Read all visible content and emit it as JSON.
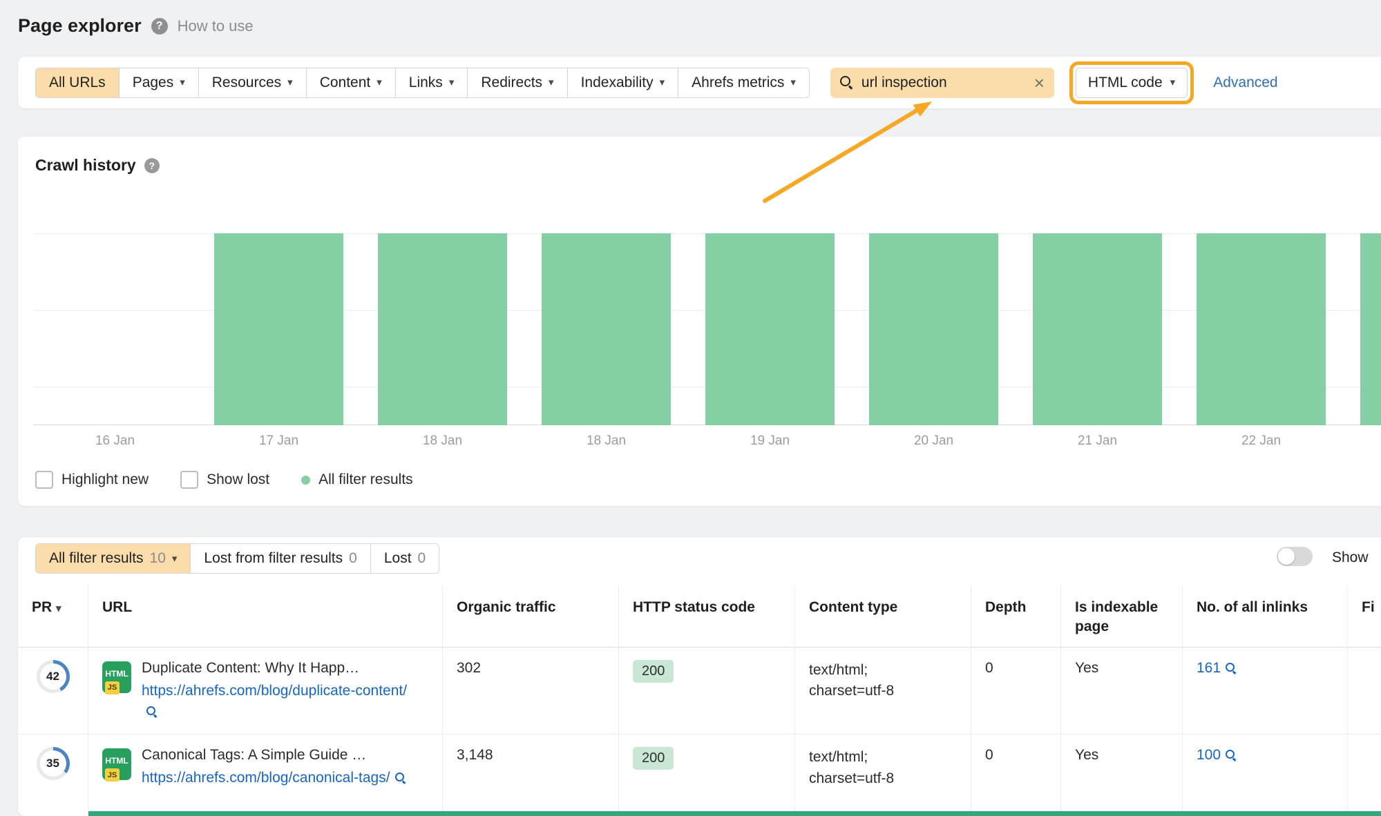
{
  "page": {
    "title": "Page explorer",
    "help_label": "How to use"
  },
  "colors": {
    "accent_orange_bg": "#FBDCAB",
    "annotation_orange": "#F6A723",
    "bar_green": "#84CFA3",
    "status_ok_bg": "#C9E7D4",
    "link_blue": "#1567C3",
    "new_row_green": "#2EA879"
  },
  "annotation": {
    "color": "#F6A723"
  },
  "filter_bar": {
    "tabs": [
      {
        "label": "All URLs",
        "active": true,
        "has_caret": false
      },
      {
        "label": "Pages",
        "has_caret": true
      },
      {
        "label": "Resources",
        "has_caret": true
      },
      {
        "label": "Content",
        "has_caret": true
      },
      {
        "label": "Links",
        "has_caret": true
      },
      {
        "label": "Redirects",
        "has_caret": true
      },
      {
        "label": "Indexability",
        "has_caret": true
      },
      {
        "label": "Ahrefs metrics",
        "has_caret": true
      }
    ],
    "search_value": "url inspection",
    "html_code_label": "HTML code",
    "advanced_label": "Advanced"
  },
  "crawl_history": {
    "title": "Crawl history",
    "highlight_new_label": "Highlight new",
    "show_lost_label": "Show lost",
    "legend_label": "All filter results"
  },
  "chart_data": {
    "type": "bar",
    "title": "Crawl history",
    "categories": [
      "16 Jan",
      "17 Jan",
      "18 Jan",
      "18 Jan",
      "19 Jan",
      "20 Jan",
      "21 Jan",
      "22 Jan"
    ],
    "values": [
      0,
      10,
      10,
      10,
      10,
      10,
      10,
      10
    ],
    "series_name": "All filter results",
    "xlabel": "",
    "ylabel": "",
    "ylim": [
      0,
      10
    ],
    "grid": true,
    "legend_position": "bottom-left",
    "bar_color": "#84CFA3",
    "extra_partial_bar_right": true
  },
  "results": {
    "tabs": [
      {
        "label": "All filter results",
        "count": "10",
        "active": true,
        "has_caret": true
      },
      {
        "label": "Lost from filter results",
        "count": "0",
        "has_caret": false
      },
      {
        "label": "Lost",
        "count": "0",
        "has_caret": false
      }
    ],
    "show_toggle_label": "Show",
    "columns": [
      "PR",
      "URL",
      "Organic traffic",
      "HTTP status code",
      "Content type",
      "Depth",
      "Is indexable page",
      "No. of all inlinks",
      "Fi"
    ],
    "file_icon_labels": {
      "html": "HTML",
      "js": "JS"
    },
    "rows": [
      {
        "pr": "42",
        "title": "Duplicate Content: Why It Happ…",
        "url": "https://ahrefs.com/blog/duplicate-content/",
        "organic_traffic": "302",
        "http_status": "200",
        "content_type_line1": "text/html;",
        "content_type_line2": "charset=utf-8",
        "depth": "0",
        "is_indexable": "Yes",
        "inlinks": "161"
      },
      {
        "pr": "35",
        "title": "Canonical Tags: A Simple Guide …",
        "url": "https://ahrefs.com/blog/canonical-tags/",
        "organic_traffic": "3,148",
        "http_status": "200",
        "content_type_line1": "text/html;",
        "content_type_line2": "charset=utf-8",
        "depth": "0",
        "is_indexable": "Yes",
        "inlinks": "100"
      }
    ]
  }
}
